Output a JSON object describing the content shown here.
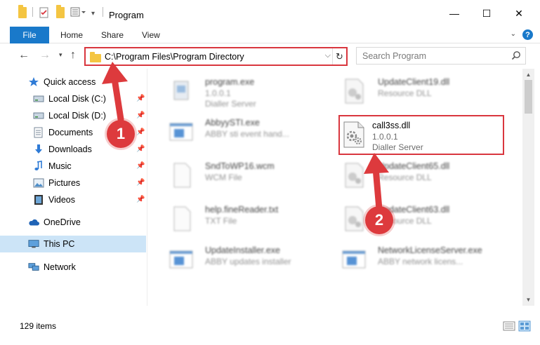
{
  "window": {
    "title": "Program",
    "minimize": "—",
    "maximize": "☐",
    "close": "✕"
  },
  "ribbon": {
    "file": "File",
    "tabs": [
      "Home",
      "Share",
      "View"
    ],
    "help": "?"
  },
  "address": {
    "path": "C:\\Program Files\\Program Directory",
    "search_placeholder": "Search Program"
  },
  "sidebar": {
    "items": [
      {
        "label": "Quick access",
        "icon": "star-icon",
        "pinned": false
      },
      {
        "label": "Local Disk (C:)",
        "icon": "drive-icon",
        "pinned": true
      },
      {
        "label": "Local Disk (D:)",
        "icon": "drive-icon",
        "pinned": true
      },
      {
        "label": "Documents",
        "icon": "document-icon",
        "pinned": true
      },
      {
        "label": "Downloads",
        "icon": "download-icon",
        "pinned": true
      },
      {
        "label": "Music",
        "icon": "music-icon",
        "pinned": true
      },
      {
        "label": "Pictures",
        "icon": "picture-icon",
        "pinned": true
      },
      {
        "label": "Videos",
        "icon": "video-icon",
        "pinned": true
      },
      {
        "label": "OneDrive",
        "icon": "cloud-icon",
        "pinned": false
      },
      {
        "label": "This PC",
        "icon": "computer-icon",
        "pinned": false,
        "selected": true
      },
      {
        "label": "Network",
        "icon": "network-icon",
        "pinned": false
      }
    ]
  },
  "files": [
    {
      "name": "program.exe",
      "line2": "1.0.0.1",
      "line3": "Dialler Server",
      "type": "exe-icon",
      "blurred": true
    },
    {
      "name": "UpdateClient19.dll",
      "line2": "Resource DLL",
      "line3": "",
      "type": "dll-icon",
      "blurred": true
    },
    {
      "name": "AbbyySTI.exe",
      "line2": "ABBY sti event hand...",
      "line3": "",
      "type": "app-icon",
      "blurred": true
    },
    {
      "name": "call3ss.dll",
      "line2": "1.0.0.1",
      "line3": "Dialler Server",
      "type": "dll-icon",
      "blurred": false
    },
    {
      "name": "SndToWP16.wcm",
      "line2": "WCM File",
      "line3": "",
      "type": "blank-file-icon",
      "blurred": true
    },
    {
      "name": "UpdateClient65.dll",
      "line2": "Resource DLL",
      "line3": "",
      "type": "dll-icon",
      "blurred": true
    },
    {
      "name": "help.fineReader.txt",
      "line2": "TXT File",
      "line3": "",
      "type": "blank-file-icon",
      "blurred": true
    },
    {
      "name": "UpdateClient63.dll",
      "line2": "Resource DLL",
      "line3": "",
      "type": "dll-icon",
      "blurred": true
    },
    {
      "name": "UpdateInstaller.exe",
      "line2": "ABBY updates installer",
      "line3": "",
      "type": "app-icon",
      "blurred": true
    },
    {
      "name": "NetworkLicenseServer.exe",
      "line2": "ABBY network licens...",
      "line3": "",
      "type": "app-icon",
      "blurred": true
    }
  ],
  "status": {
    "count": "129 items"
  },
  "callouts": [
    "1",
    "2"
  ],
  "colors": {
    "accent": "#1979ca",
    "highlight": "#d9363e",
    "selected": "#cce4f7"
  }
}
